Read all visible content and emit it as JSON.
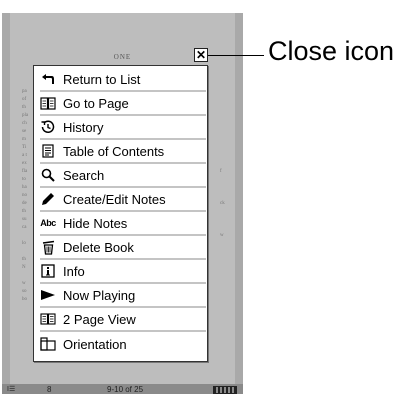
{
  "book": {
    "page_heading": "ONE",
    "status": {
      "left": "I☰",
      "page": "8",
      "range": "9-10 of 25"
    }
  },
  "close": {
    "glyph": "✕",
    "callout": "Close icon"
  },
  "menu": {
    "items": [
      {
        "label": "Return to List",
        "icon": "return-arrow-icon"
      },
      {
        "label": "Go to Page",
        "icon": "open-book-icon"
      },
      {
        "label": "History",
        "icon": "history-clock-icon"
      },
      {
        "label": "Table of Contents",
        "icon": "document-list-icon"
      },
      {
        "label": "Search",
        "icon": "search-icon"
      },
      {
        "label": "Create/Edit Notes",
        "icon": "pencil-icon"
      },
      {
        "label": "Hide Notes",
        "icon": "abc-text-icon",
        "icon_text": "Abc"
      },
      {
        "label": "Delete Book",
        "icon": "trash-icon"
      },
      {
        "label": "Info",
        "icon": "info-icon"
      },
      {
        "label": "Now Playing",
        "icon": "play-icon"
      },
      {
        "label": "2 Page View",
        "icon": "two-page-icon"
      },
      {
        "label": "Orientation",
        "icon": "orientation-icon"
      }
    ]
  }
}
